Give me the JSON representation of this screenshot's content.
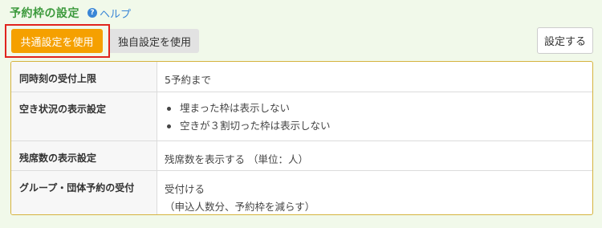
{
  "header": {
    "title": "予約枠の設定",
    "help_label": "ヘルプ"
  },
  "toggle": {
    "common_label": "共通設定を使用",
    "custom_label": "独自設定を使用"
  },
  "actions": {
    "settings_label": "設定する"
  },
  "settings": {
    "rows": [
      {
        "label": "同時刻の受付上限",
        "value": "5予約まで"
      },
      {
        "label": "空き状況の表示設定",
        "items": [
          "埋まった枠は表示しない",
          "空きが３割切った枠は表示しない"
        ]
      },
      {
        "label": "残席数の表示設定",
        "value": "残席数を表示する （単位：人）"
      },
      {
        "label": "グループ・団体予約の受付",
        "value": "受付ける",
        "note": "（申込人数分、予約枠を減らす）"
      }
    ]
  },
  "colors": {
    "title": "#3c9a3c",
    "link": "#3a86d6",
    "active_button": "#f5a000",
    "highlight_border": "#e0241e",
    "table_border": "#d5b33e"
  }
}
